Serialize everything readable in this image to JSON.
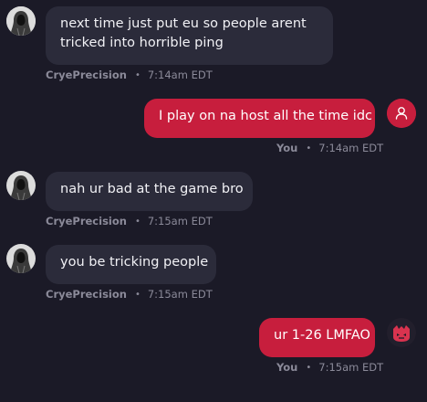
{
  "colors": {
    "background": "#1b1a27",
    "incoming_bubble": "#2b2b3a",
    "outgoing_bubble": "#c71e3d",
    "meta_text": "#8b8a99"
  },
  "messages": [
    {
      "direction": "incoming",
      "avatar_icon": "hooded-figure-avatar",
      "lines": [
        "next time just put eu so people arent",
        "tricked into horrible ping"
      ],
      "author": "CryePrecision",
      "time": "7:14am EDT"
    },
    {
      "direction": "outgoing",
      "avatar_icon": "user-icon",
      "lines": [
        "I play on na host all the time idc"
      ],
      "author": "You",
      "time": "7:14am EDT"
    },
    {
      "direction": "incoming",
      "avatar_icon": "hooded-figure-avatar",
      "lines": [
        "nah ur bad at the game bro"
      ],
      "author": "CryePrecision",
      "time": "7:15am EDT"
    },
    {
      "direction": "incoming",
      "avatar_icon": "hooded-figure-avatar",
      "lines": [
        "you be tricking people"
      ],
      "author": "CryePrecision",
      "time": "7:15am EDT"
    },
    {
      "direction": "outgoing",
      "avatar_icon": "game-mascot-icon",
      "lines": [
        "ur 1-26 LMFAO"
      ],
      "author": "You",
      "time": "7:15am EDT"
    }
  ],
  "separator": "•"
}
